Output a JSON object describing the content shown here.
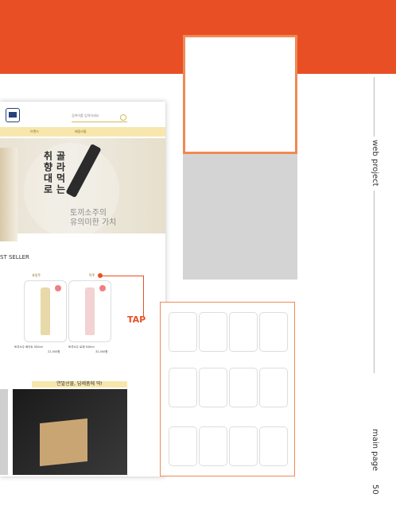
{
  "search": {
    "placeholder": "검색어를 입력하세요"
  },
  "nav": {
    "items": [
      "브랜드",
      "패밀리몰"
    ]
  },
  "hero": {
    "vertical_left": "취향대로",
    "vertical_right": "골라먹는",
    "subtitle_line1": "토끼소주의",
    "subtitle_line2": "유의미한 가치"
  },
  "section": {
    "best": "ST SELLER"
  },
  "products": [
    {
      "tag": "과일주",
      "name": "토끼소주 화이트 500ml",
      "price": "22,500원"
    },
    {
      "tag": "탁주",
      "name": "토끼소주 로제 500ml",
      "price": "32,000원"
    }
  ],
  "promo": {
    "title": "연말선물, 답례품에 딱!"
  },
  "tap": {
    "label": "TAP"
  },
  "side": {
    "web": "web project",
    "main": "main page",
    "page": "50"
  },
  "colors": {
    "accent": "#e94f25",
    "gold": "#f7e7ad",
    "navy": "#26437a"
  }
}
